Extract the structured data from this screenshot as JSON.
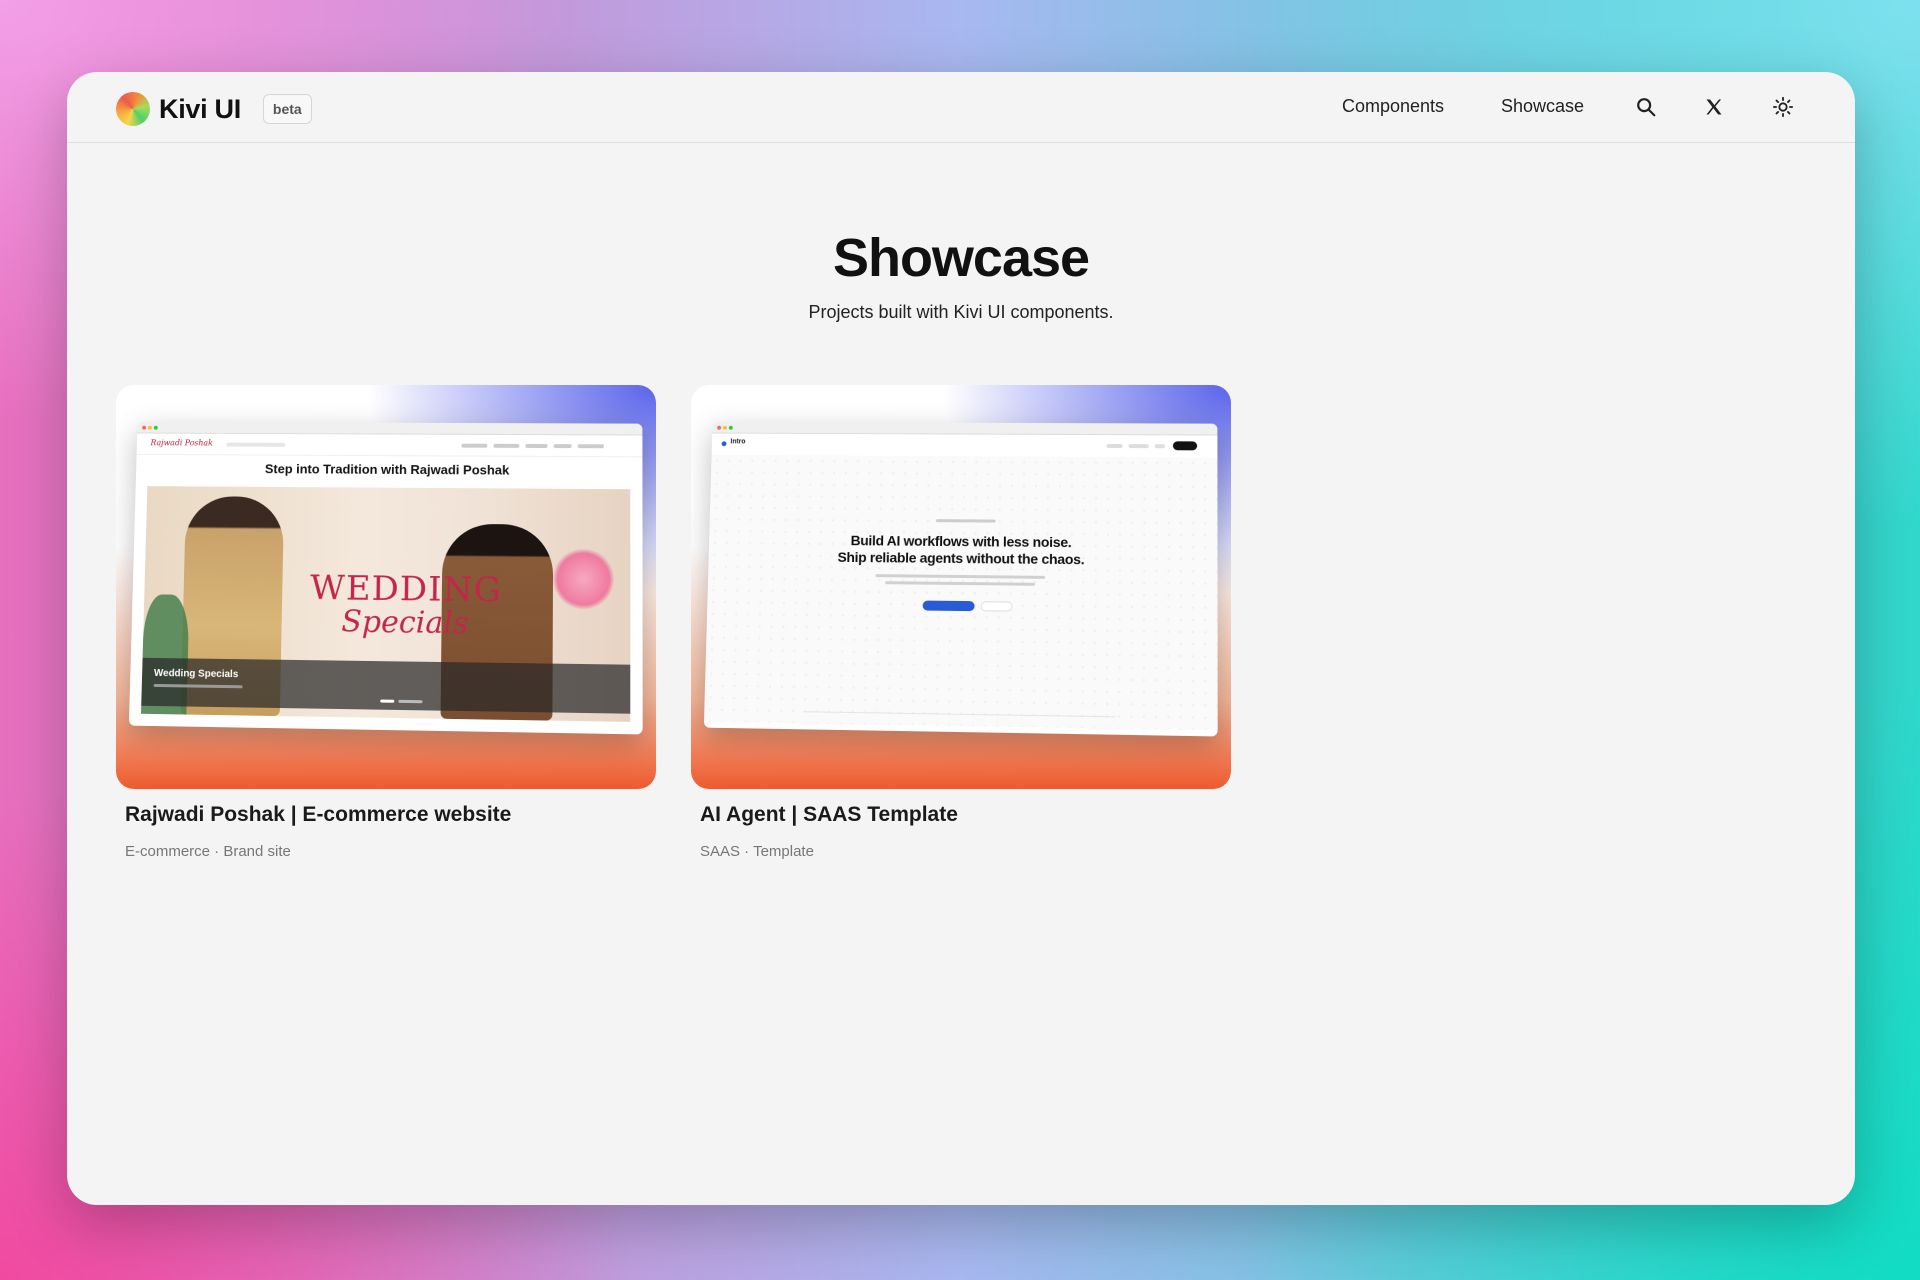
{
  "app": {
    "brand": "Kivi UI",
    "badge": "beta"
  },
  "nav": {
    "links": [
      "Components",
      "Showcase"
    ],
    "icons": [
      "search-icon",
      "x-logo-icon",
      "sun-icon"
    ]
  },
  "page": {
    "title": "Showcase",
    "subtitle": "Projects built with Kivi UI components."
  },
  "cards": [
    {
      "title": "Rajwadi Poshak | E-commerce website",
      "tags": "E-commerce · Brand site",
      "preview": {
        "logo": "Rajwadi Poshak",
        "headline": "Step into Tradition with Rajwadi Poshak",
        "banner_title": "WEDDING",
        "banner_script": "Specials",
        "caption": "Wedding Specials"
      }
    },
    {
      "title": "AI Agent | SAAS Template",
      "tags": "SAAS · Template",
      "preview": {
        "logo": "Intro",
        "headline_1": "Build AI workflows with less noise.",
        "headline_2": "Ship reliable agents without the chaos."
      }
    }
  ],
  "colors": {
    "accent_orange": "#ee5a2e",
    "accent_indigo": "#5a64ea",
    "cta_blue": "#2a5bd7"
  }
}
